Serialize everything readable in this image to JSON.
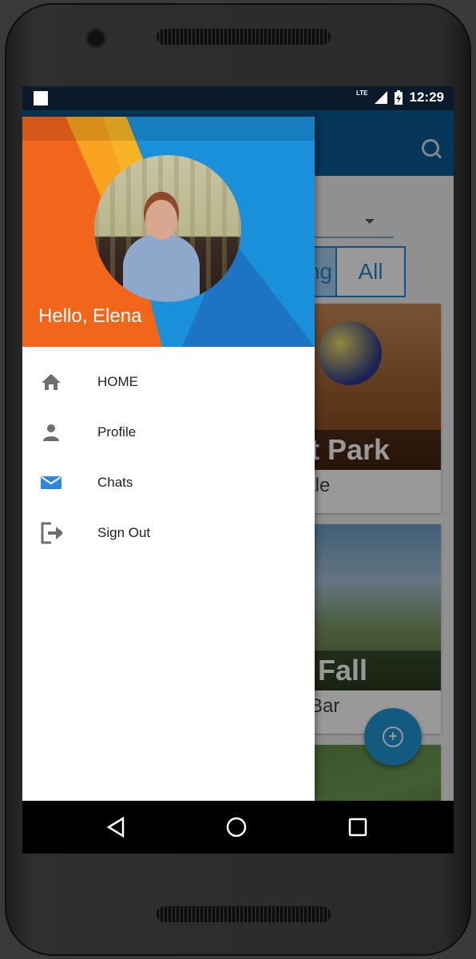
{
  "status_bar": {
    "network": "LTE",
    "time": "12:29"
  },
  "app": {
    "segment_left": "ng",
    "segment_right": "All",
    "cards": [
      {
        "title": "at Park",
        "subtitle": "attle"
      },
      {
        "title": "e Fall",
        "subtitle": "d Bar"
      }
    ]
  },
  "drawer": {
    "greeting": "Hello, Elena",
    "items": [
      {
        "label": "HOME",
        "icon": "home-icon"
      },
      {
        "label": "Profile",
        "icon": "person-icon"
      },
      {
        "label": "Chats",
        "icon": "mail-icon"
      },
      {
        "label": "Sign Out",
        "icon": "exit-icon"
      }
    ]
  },
  "colors": {
    "drawer_header_blue": "#1a8fda",
    "drawer_header_orange": "#f2661c",
    "accent": "#2196d8",
    "mail_icon": "#2d86e0"
  }
}
